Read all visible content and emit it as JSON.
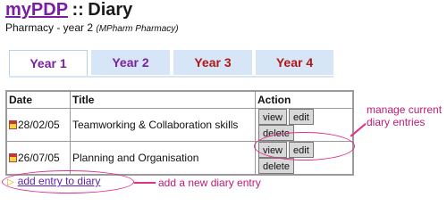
{
  "header": {
    "logo": "myPDP",
    "separator": "::",
    "page": "Diary"
  },
  "subtitle": {
    "text": "Pharmacy - year 2",
    "programme": "(MPharm Pharmacy)"
  },
  "tabs": [
    {
      "label": "Year 1",
      "active": true
    },
    {
      "label": "Year 2",
      "active": false
    },
    {
      "label": "Year 3",
      "active": false
    },
    {
      "label": "Year 4",
      "active": false
    }
  ],
  "table": {
    "headers": [
      "Date",
      "Title",
      "Action"
    ],
    "rows": [
      {
        "date": "28/02/05",
        "title": "Teamworking & Collaboration skills"
      },
      {
        "date": "26/07/05",
        "title": "Planning and Organisation"
      }
    ],
    "actions": [
      "view",
      "edit",
      "delete"
    ]
  },
  "add_link": {
    "label": "add entry to diary"
  },
  "annotations": {
    "manage": "manage current\ndiary entries",
    "add": "add a new diary entry"
  },
  "colors": {
    "accent": "#7a1fa0",
    "annotation": "#e0308a",
    "tab_bg": "#d6e6f7"
  }
}
